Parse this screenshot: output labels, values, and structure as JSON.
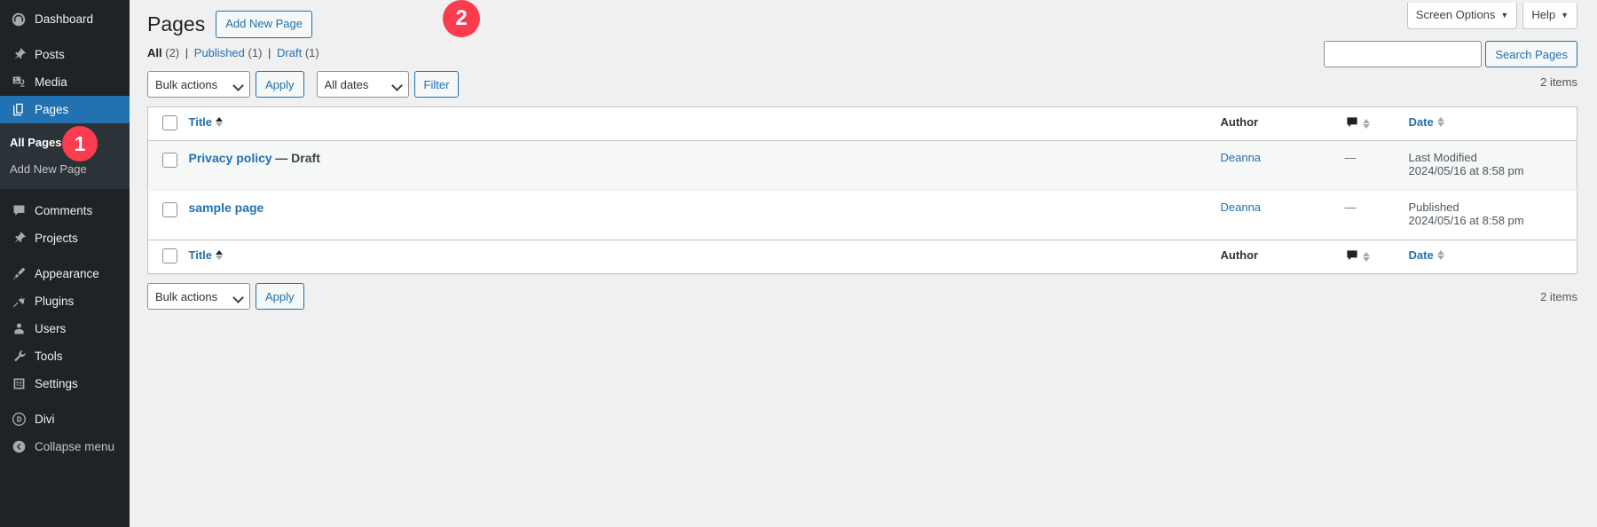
{
  "sidebar": {
    "items": [
      {
        "label": "Dashboard",
        "icon": "dashboard-icon",
        "name": "dashboard"
      },
      {
        "label": "Posts",
        "icon": "pin-icon",
        "name": "posts"
      },
      {
        "label": "Media",
        "icon": "media-icon",
        "name": "media"
      },
      {
        "label": "Pages",
        "icon": "pages-icon",
        "name": "pages",
        "active": true
      },
      {
        "label": "Comments",
        "icon": "comment-icon",
        "name": "comments"
      },
      {
        "label": "Projects",
        "icon": "pin-icon",
        "name": "projects"
      },
      {
        "label": "Appearance",
        "icon": "brush-icon",
        "name": "appearance"
      },
      {
        "label": "Plugins",
        "icon": "plug-icon",
        "name": "plugins"
      },
      {
        "label": "Users",
        "icon": "user-icon",
        "name": "users"
      },
      {
        "label": "Tools",
        "icon": "wrench-icon",
        "name": "tools"
      },
      {
        "label": "Settings",
        "icon": "settings-icon",
        "name": "settings"
      },
      {
        "label": "Divi",
        "icon": "divi-icon",
        "name": "divi"
      },
      {
        "label": "Collapse menu",
        "icon": "collapse-icon",
        "name": "collapse"
      }
    ],
    "submenu": {
      "all_pages": "All Pages",
      "add_new_page": "Add New Page"
    },
    "badge_1": "1"
  },
  "topbar": {
    "screen_options": "Screen Options",
    "help": "Help",
    "caret": "▼"
  },
  "header": {
    "title": "Pages",
    "add_new_button": "Add New Page",
    "badge_2": "2"
  },
  "filters": {
    "all_label": "All",
    "all_count": "(2)",
    "published_label": "Published",
    "published_count": "(1)",
    "draft_label": "Draft",
    "draft_count": "(1)",
    "separator": "|"
  },
  "search": {
    "value": "",
    "placeholder": "",
    "button": "Search Pages"
  },
  "tablenav": {
    "bulk_actions": "Bulk actions",
    "apply": "Apply",
    "all_dates": "All dates",
    "filter": "Filter",
    "items_top": "2 items",
    "items_bottom": "2 items"
  },
  "table": {
    "columns": {
      "title": "Title",
      "author": "Author",
      "comments": "comment-bubble-icon",
      "date": "Date"
    },
    "rows": [
      {
        "title": "Privacy policy",
        "status_suffix": "— Draft",
        "author": "Deanna",
        "comments": "—",
        "date_label": "Last Modified",
        "date_value": "2024/05/16 at 8:58 pm"
      },
      {
        "title": "sample page",
        "status_suffix": "",
        "author": "Deanna",
        "comments": "—",
        "date_label": "Published",
        "date_value": "2024/05/16 at 8:58 pm"
      }
    ]
  },
  "colors": {
    "sidebar_bg": "#1d2327",
    "active_blue": "#2271b1",
    "badge_red": "#fb3b4e",
    "page_bg": "#f0f0f1"
  }
}
